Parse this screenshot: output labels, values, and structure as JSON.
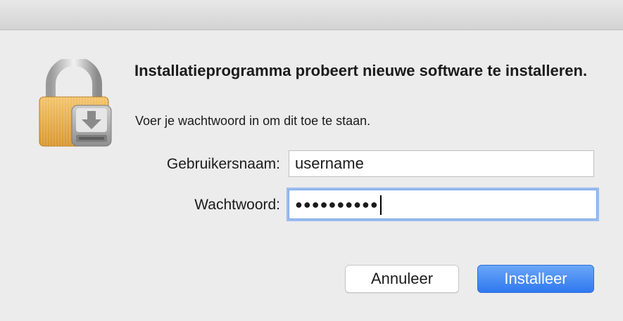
{
  "dialog": {
    "title": "Installatieprogramma probeert nieuwe software te installeren.",
    "subtitle": "Voer je wachtwoord in om dit toe te staan.",
    "icon": "lock-install-icon"
  },
  "form": {
    "username_label": "Gebruikersnaam:",
    "username_value": "username",
    "password_label": "Wachtwoord:",
    "password_masked": "●●●●●●●●●●"
  },
  "buttons": {
    "cancel_label": "Annuleer",
    "install_label": "Installeer"
  },
  "colors": {
    "accent": "#2f78f0",
    "focus_ring": "#9bbcf0"
  }
}
